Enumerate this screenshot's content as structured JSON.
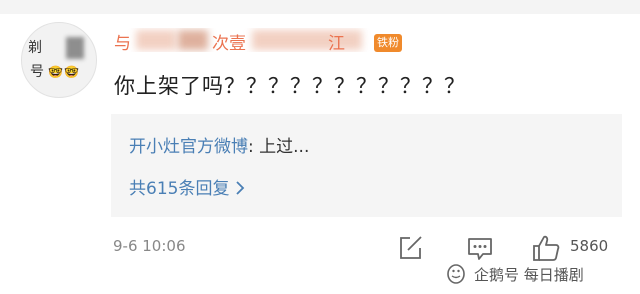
{
  "comment": {
    "avatar": {
      "text_line1": "剃",
      "text_line2": "号",
      "emoji": "🤓"
    },
    "username": {
      "visible_fragment_1": "与",
      "visible_fragment_2": "次壹",
      "visible_fragment_3": "江",
      "badge": "铁粉"
    },
    "text": "你上架了吗？？？？？？？？？？？",
    "reply": {
      "author": "开小灶官方微博",
      "separator": ": ",
      "text": "上过...",
      "more_label": "共615条回复 ",
      "more_icon": "chevron-right-icon"
    },
    "timestamp": "9-6 10:06",
    "actions": {
      "share_icon": "share-icon",
      "comment_icon": "comment-icon",
      "like_icon": "thumbs-up-icon",
      "like_count": "5860"
    }
  },
  "watermark": {
    "icon": "penguin-logo",
    "text": "企鹅号 每日播剧"
  },
  "colors": {
    "username": "#eb7350",
    "reply_author": "#4a7fb5",
    "badge": "#f08a2c",
    "reply_bg": "#f5f5f5"
  }
}
